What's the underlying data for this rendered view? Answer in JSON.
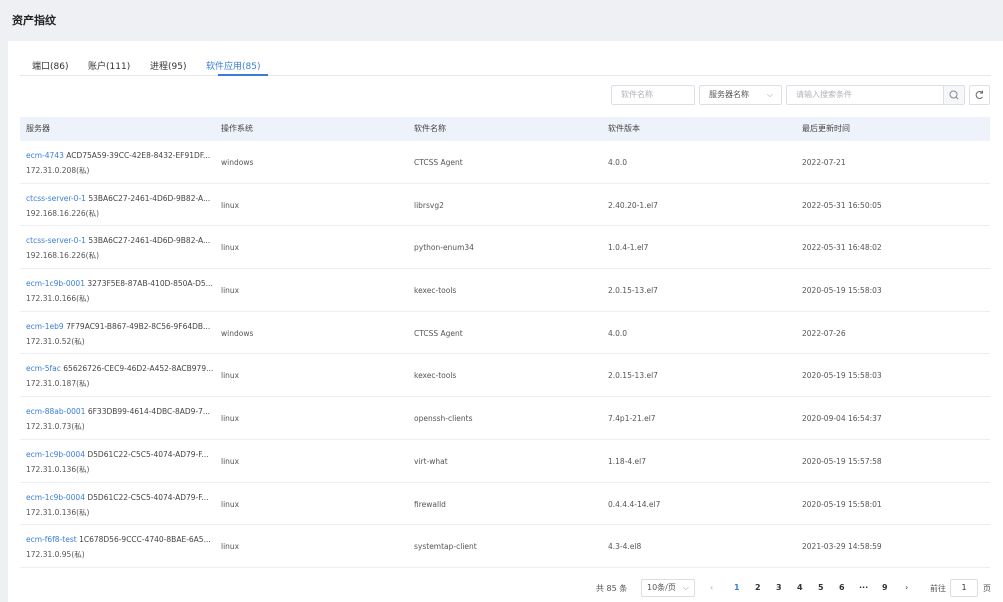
{
  "page_title": "资产指纹",
  "tabs": [
    {
      "label": "端口(86)"
    },
    {
      "label": "账户(111)"
    },
    {
      "label": "进程(95)"
    },
    {
      "label": "软件应用(85)"
    }
  ],
  "filters": {
    "software_name_placeholder": "软件名称",
    "server_select_value": "服务器名称",
    "search_placeholder": "请输入搜索条件"
  },
  "table": {
    "headers": [
      "服务器",
      "操作系统",
      "软件名称",
      "软件版本",
      "最后更新时间"
    ],
    "rows": [
      {
        "server": "ecm-4743",
        "uuid": "ACD75A59-39CC-42E8-8432-EF91DF...",
        "ip": "172.31.0.208(私)",
        "os": "windows",
        "software": "CTCSS Agent",
        "version": "4.0.0",
        "updated": "2022-07-21"
      },
      {
        "server": "ctcss-server-0-1",
        "uuid": "53BA6C27-2461-4D6D-9B82-A...",
        "ip": "192.168.16.226(私)",
        "os": "linux",
        "software": "librsvg2",
        "version": "2.40.20-1.el7",
        "updated": "2022-05-31 16:50:05"
      },
      {
        "server": "ctcss-server-0-1",
        "uuid": "53BA6C27-2461-4D6D-9B82-A...",
        "ip": "192.168.16.226(私)",
        "os": "linux",
        "software": "python-enum34",
        "version": "1.0.4-1.el7",
        "updated": "2022-05-31 16:48:02"
      },
      {
        "server": "ecm-1c9b-0001",
        "uuid": "3273F5E8-87AB-410D-850A-D5...",
        "ip": "172.31.0.166(私)",
        "os": "linux",
        "software": "kexec-tools",
        "version": "2.0.15-13.el7",
        "updated": "2020-05-19 15:58:03"
      },
      {
        "server": "ecm-1eb9",
        "uuid": "7F79AC91-B867-49B2-8C56-9F64DB...",
        "ip": "172.31.0.52(私)",
        "os": "windows",
        "software": "CTCSS Agent",
        "version": "4.0.0",
        "updated": "2022-07-26"
      },
      {
        "server": "ecm-5fac",
        "uuid": "65626726-CEC9-46D2-A452-8ACB979...",
        "ip": "172.31.0.187(私)",
        "os": "linux",
        "software": "kexec-tools",
        "version": "2.0.15-13.el7",
        "updated": "2020-05-19 15:58:03"
      },
      {
        "server": "ecm-88ab-0001",
        "uuid": "6F33DB99-4614-4DBC-8AD9-7...",
        "ip": "172.31.0.73(私)",
        "os": "linux",
        "software": "openssh-clients",
        "version": "7.4p1-21.el7",
        "updated": "2020-09-04 16:54:37"
      },
      {
        "server": "ecm-1c9b-0004",
        "uuid": "D5D61C22-C5C5-4074-AD79-F...",
        "ip": "172.31.0.136(私)",
        "os": "linux",
        "software": "virt-what",
        "version": "1.18-4.el7",
        "updated": "2020-05-19 15:57:58"
      },
      {
        "server": "ecm-1c9b-0004",
        "uuid": "D5D61C22-C5C5-4074-AD79-F...",
        "ip": "172.31.0.136(私)",
        "os": "linux",
        "software": "firewalld",
        "version": "0.4.4.4-14.el7",
        "updated": "2020-05-19 15:58:01"
      },
      {
        "server": "ecm-f6f8-test",
        "uuid": "1C678D56-9CCC-4740-8BAE-6A5...",
        "ip": "172.31.0.95(私)",
        "os": "linux",
        "software": "systemtap-client",
        "version": "4.3-4.el8",
        "updated": "2021-03-29 14:58:59"
      }
    ]
  },
  "pagination": {
    "total_text": "共 85 条",
    "page_size": "10条/页",
    "pages": [
      "1",
      "2",
      "3",
      "4",
      "5",
      "6"
    ],
    "ellipsis": "···",
    "last_page": "9",
    "current_page": "1",
    "goto_label": "前往",
    "goto_value": "1",
    "goto_suffix": "页"
  },
  "colors": {
    "accent": "#3a7dd6",
    "header_bg": "#eef3fb",
    "page_bg": "#eef0f4"
  }
}
